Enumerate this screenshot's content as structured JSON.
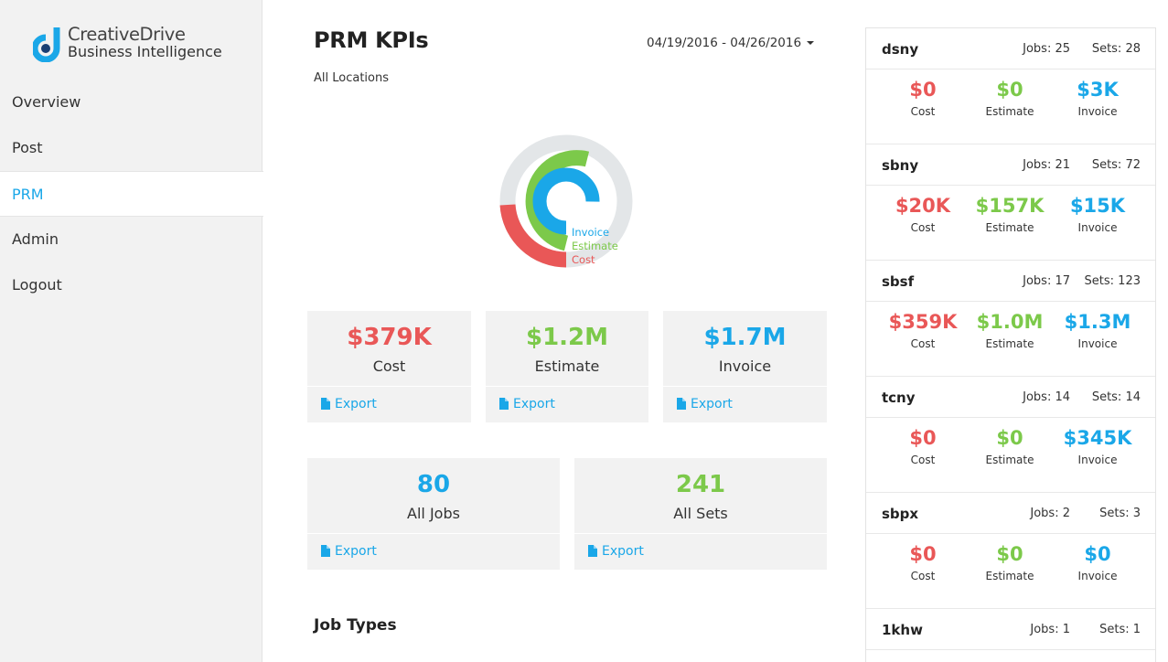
{
  "brand": {
    "line1": "CreativeDrive",
    "line2": "Business Intelligence"
  },
  "nav": [
    {
      "label": "Overview",
      "active": false
    },
    {
      "label": "Post",
      "active": false
    },
    {
      "label": "PRM",
      "active": true
    },
    {
      "label": "Admin",
      "active": false
    },
    {
      "label": "Logout",
      "active": false
    }
  ],
  "header": {
    "title": "PRM KPIs",
    "subtitle": "All Locations",
    "date_range": "04/19/2016 - 04/26/2016"
  },
  "donut": {
    "legend": [
      "Invoice",
      "Estimate",
      "Cost"
    ],
    "colors": {
      "invoice": "#1aa7e8",
      "estimate": "#7cc94a",
      "cost": "#e95757",
      "track": "#e3e6e8"
    }
  },
  "kpis": [
    {
      "value": "$379K",
      "label": "Cost",
      "export": "Export"
    },
    {
      "value": "$1.2M",
      "label": "Estimate",
      "export": "Export"
    },
    {
      "value": "$1.7M",
      "label": "Invoice",
      "export": "Export"
    }
  ],
  "counts": [
    {
      "value": "80",
      "label": "All Jobs",
      "export": "Export"
    },
    {
      "value": "241",
      "label": "All Sets",
      "export": "Export"
    }
  ],
  "section_title": "Job Types",
  "locations": [
    {
      "name": "dsny",
      "jobs": "Jobs: 25",
      "sets": "Sets: 28",
      "cost": "$0",
      "estimate": "$0",
      "invoice": "$3K"
    },
    {
      "name": "sbny",
      "jobs": "Jobs: 21",
      "sets": "Sets: 72",
      "cost": "$20K",
      "estimate": "$157K",
      "invoice": "$15K"
    },
    {
      "name": "sbsf",
      "jobs": "Jobs: 17",
      "sets": "Sets: 123",
      "cost": "$359K",
      "estimate": "$1.0M",
      "invoice": "$1.3M"
    },
    {
      "name": "tcny",
      "jobs": "Jobs: 14",
      "sets": "Sets: 14",
      "cost": "$0",
      "estimate": "$0",
      "invoice": "$345K"
    },
    {
      "name": "sbpx",
      "jobs": "Jobs: 2",
      "sets": "Sets: 3",
      "cost": "$0",
      "estimate": "$0",
      "invoice": "$0"
    },
    {
      "name": "1khw",
      "jobs": "Jobs: 1",
      "sets": "Sets: 1"
    }
  ],
  "metric_labels": {
    "cost": "Cost",
    "estimate": "Estimate",
    "invoice": "Invoice"
  }
}
